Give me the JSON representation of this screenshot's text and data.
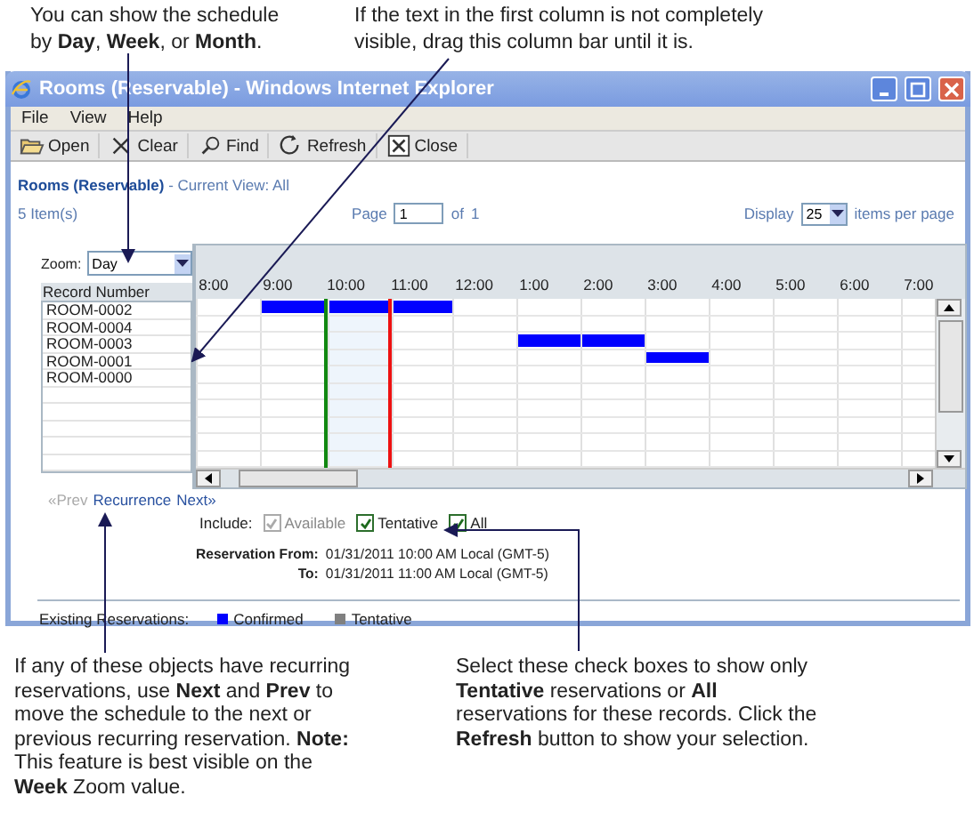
{
  "callouts_top": [
    "You can show the schedule by **Day**, **Week**, or **Month**.",
    "If the text in the first column is not completely visible, drag this column bar until it is."
  ],
  "window": {
    "title": "Rooms (Reservable) - Windows Internet Explorer"
  },
  "menu": [
    "File",
    "View",
    "Help"
  ],
  "toolbar": [
    {
      "label": "Open",
      "kind": "open"
    },
    {
      "label": "Clear",
      "kind": "clear"
    },
    {
      "label": "Find",
      "kind": "find"
    },
    {
      "label": "Refresh",
      "kind": "refresh"
    },
    {
      "label": "Close",
      "kind": "close"
    }
  ],
  "breadcrumb": {
    "title": "Rooms (Reservable)",
    "view_label": "- Current View:",
    "view": "All"
  },
  "item_count": "5 Item(s)",
  "pager": {
    "page_label": "Page",
    "page": "1",
    "of_label": "of",
    "pages": "1",
    "display_label": "Display",
    "per_page": "25",
    "per_page_label": "items per page"
  },
  "zoom": {
    "label": "Zoom:",
    "value": "Day"
  },
  "grid": {
    "column": "Record Number",
    "hours": [
      {
        "label": "8:00",
        "start_line": false,
        "end_line": false
      },
      {
        "label": "9:00",
        "start_line": false,
        "end_line": false
      },
      {
        "label": "10:00",
        "start_line": true,
        "end_line": false
      },
      {
        "label": "11:00",
        "start_line": false,
        "end_line": true
      },
      {
        "label": "12:00",
        "start_line": false,
        "end_line": false
      },
      {
        "label": "1:00",
        "start_line": false,
        "end_line": false
      },
      {
        "label": "2:00",
        "start_line": false,
        "end_line": false
      },
      {
        "label": "3:00",
        "start_line": false,
        "end_line": false
      },
      {
        "label": "4:00",
        "start_line": false,
        "end_line": false
      },
      {
        "label": "5:00",
        "start_line": false,
        "end_line": false
      },
      {
        "label": "6:00",
        "start_line": false,
        "end_line": false
      },
      {
        "label": "7:00",
        "start_line": false,
        "end_line": false
      }
    ],
    "rows": [
      {
        "name": "ROOM-0002",
        "booked": [
          false,
          true,
          true,
          true,
          false,
          false,
          false,
          false,
          false,
          false,
          false,
          false
        ]
      },
      {
        "name": "ROOM-0004",
        "booked": [
          false,
          false,
          false,
          false,
          false,
          false,
          false,
          false,
          false,
          false,
          false,
          false
        ]
      },
      {
        "name": "ROOM-0003",
        "booked": [
          false,
          false,
          false,
          false,
          false,
          true,
          true,
          false,
          false,
          false,
          false,
          false
        ]
      },
      {
        "name": "ROOM-0001",
        "booked": [
          false,
          false,
          false,
          false,
          false,
          false,
          false,
          true,
          false,
          false,
          false,
          false
        ]
      },
      {
        "name": "ROOM-0000",
        "booked": [
          false,
          false,
          false,
          false,
          false,
          false,
          false,
          false,
          false,
          false,
          false,
          false
        ]
      }
    ]
  },
  "recurrence": {
    "prev": "«Prev",
    "label": "Recurrence",
    "next": "Next»",
    "prev_disabled": true
  },
  "include": {
    "label": "Include:",
    "options": [
      {
        "label": "Available",
        "checked": true,
        "disabled": true
      },
      {
        "label": "Tentative",
        "checked": true,
        "disabled": false
      },
      {
        "label": "All",
        "checked": true,
        "disabled": false
      }
    ]
  },
  "reservation": {
    "from_label": "Reservation From:",
    "from": "01/31/2011 10:00 AM Local (GMT-5)",
    "to_label": "To:",
    "to": "01/31/2011 11:00 AM Local (GMT-5)"
  },
  "legend": {
    "label": "Existing Reservations:",
    "items": [
      {
        "label": "Confirmed",
        "color": "#0000ff"
      },
      {
        "label": "Tentative",
        "color": "#808080"
      }
    ]
  },
  "callouts_bottom": [
    "If any of these objects have recurring reservations, use **Next** and **Prev** to move the schedule to the next or previous recurring reservation. **Note:** This feature is best visible on the **Week** Zoom value.",
    "Select these check boxes to show only **Tentative** reservations or **All** reservations for these records. Click the **Refresh** button to show your selection."
  ]
}
